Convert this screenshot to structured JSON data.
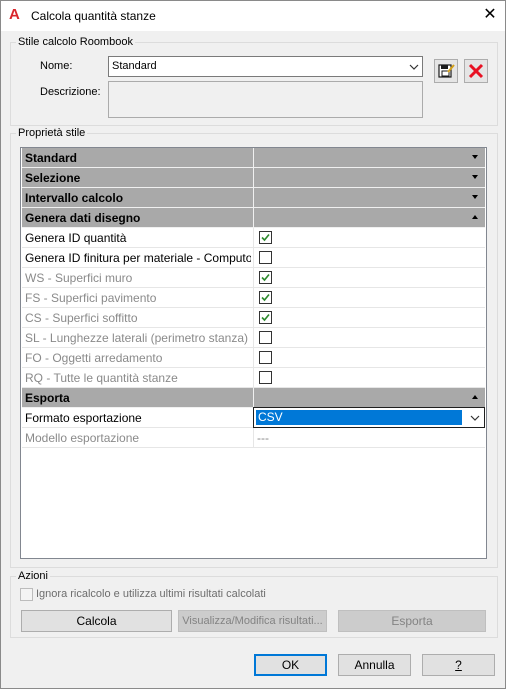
{
  "window": {
    "title": "Calcola quantità stanze",
    "close_glyph": "✕"
  },
  "style_group": {
    "legend": "Stile calcolo Roombook",
    "name_label": "Nome:",
    "name_value": "Standard",
    "desc_label": "Descrizione:",
    "desc_value": ""
  },
  "props_group": {
    "legend": "Proprietà stile"
  },
  "grid": {
    "rows": [
      {
        "label": "Standard",
        "kind": "category",
        "expanded": false
      },
      {
        "label": "Selezione",
        "kind": "category",
        "expanded": false
      },
      {
        "label": "Intervallo calcolo",
        "kind": "category",
        "expanded": false
      },
      {
        "label": "Genera dati disegno",
        "kind": "category",
        "expanded": true
      },
      {
        "label": "Genera ID quantità",
        "kind": "checkbox",
        "checked": true,
        "disabled": false
      },
      {
        "label": "Genera ID finitura per materiale - Computo",
        "kind": "checkbox",
        "checked": false,
        "disabled": false
      },
      {
        "label": "WS - Superfici muro",
        "kind": "checkbox",
        "checked": true,
        "disabled": true
      },
      {
        "label": "FS - Superfici pavimento",
        "kind": "checkbox",
        "checked": true,
        "disabled": true
      },
      {
        "label": "CS - Superfici soffitto",
        "kind": "checkbox",
        "checked": true,
        "disabled": true
      },
      {
        "label": "SL - Lunghezze laterali (perimetro stanza)",
        "kind": "checkbox",
        "checked": false,
        "disabled": true
      },
      {
        "label": "FO - Oggetti arredamento",
        "kind": "checkbox",
        "checked": false,
        "disabled": true
      },
      {
        "label": "RQ - Tutte le quantità stanze",
        "kind": "checkbox",
        "checked": false,
        "disabled": true
      },
      {
        "label": "Esporta",
        "kind": "category",
        "expanded": true
      },
      {
        "label": "Formato esportazione",
        "kind": "select",
        "value": "CSV"
      },
      {
        "label": "Modello esportazione",
        "kind": "text",
        "value": "---",
        "disabled": true
      }
    ]
  },
  "actions_group": {
    "legend": "Azioni",
    "ignore_label": "Ignora ricalcolo e utilizza ultimi risultati calcolati",
    "calc_button": "Calcola",
    "view_button": "Visualizza/Modifica risultati...",
    "export_button": "Esporta"
  },
  "footer": {
    "ok": "OK",
    "cancel": "Annulla",
    "help": "?"
  },
  "colors": {
    "accent": "#0078d7",
    "category_bg": "#a9a9a9",
    "delete_red": "#e81123",
    "check_green": "#2c8a2c"
  }
}
